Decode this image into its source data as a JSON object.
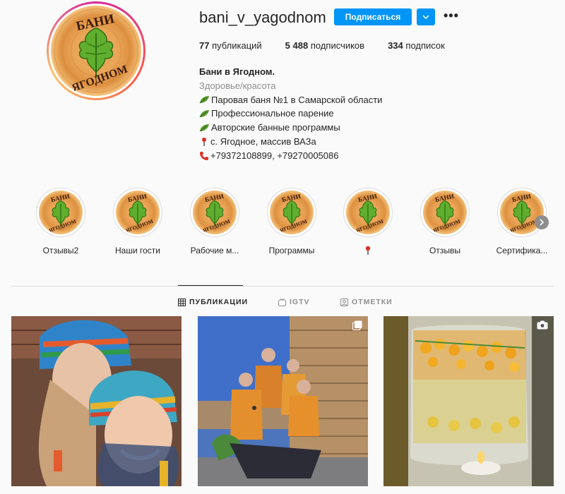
{
  "profile": {
    "username": "bani_v_yagodnom",
    "follow_label": "Подписаться",
    "logo_text": [
      "БАНИ",
      "В ЯГОДНОМ"
    ],
    "stats": {
      "posts_count": "77",
      "posts_label": "публикаций",
      "followers_count": "5 488",
      "followers_label": "подписчиков",
      "following_count": "334",
      "following_label": "подписок"
    },
    "bio": {
      "name": "Бани в Ягодном.",
      "category": "Здоровье/красота",
      "lines": [
        "Паровая баня №1 в Самарской области",
        "Профессиональное парение",
        "Авторские банные программы",
        "с. Ягодное, массив ВАЗа",
        "+79372108899, +79270005086"
      ]
    }
  },
  "highlights": [
    {
      "label": "Отзывы2"
    },
    {
      "label": "Наши гости"
    },
    {
      "label": "Рабочие м..."
    },
    {
      "label": "Программы"
    },
    {
      "label": ""
    },
    {
      "label": "Отзывы"
    },
    {
      "label": "Сертифика..."
    }
  ],
  "tabs": [
    {
      "label": "ПУБЛИКАЦИИ",
      "active": true
    },
    {
      "label": "IGTV",
      "active": false
    },
    {
      "label": "ОТМЕТКИ",
      "active": false
    }
  ],
  "colors": {
    "accent": "#0095f6",
    "text": "#262626",
    "muted": "#8e8e8e",
    "leaf": "#5a9e2f"
  },
  "icons": {
    "bio_leaf": "leaf-icon",
    "bio_pin": "pin-icon",
    "bio_phone": "phone-icon",
    "highlight_pin": "pin-icon",
    "post2_badge": "carousel-icon",
    "post3_badge": "video-icon"
  }
}
